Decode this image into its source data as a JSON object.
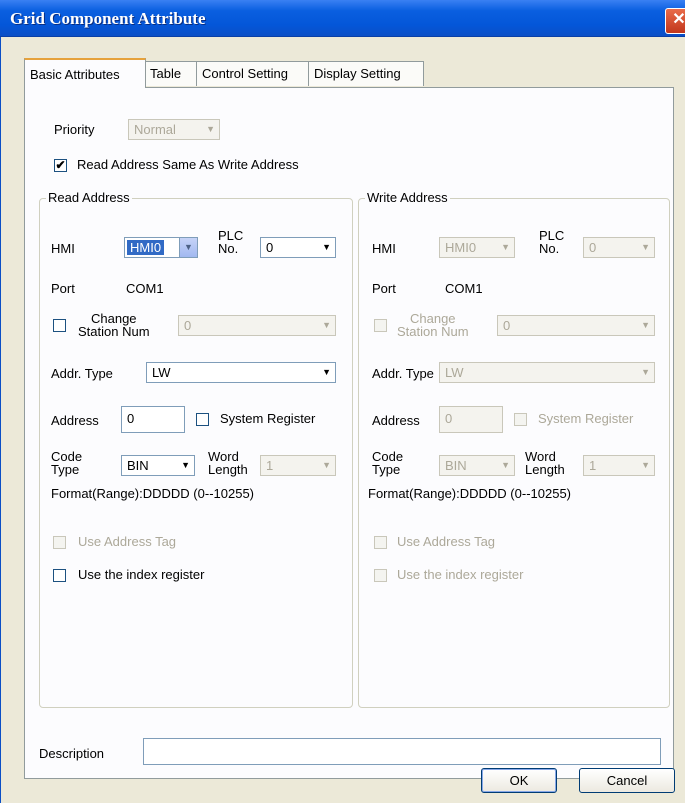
{
  "window": {
    "title": "Grid Component Attribute",
    "close_glyph": "✕"
  },
  "tabs": [
    {
      "label": "Basic Attributes"
    },
    {
      "label": "Table"
    },
    {
      "label": "Control Setting"
    },
    {
      "label": "Display Setting"
    }
  ],
  "priority": {
    "label": "Priority",
    "value": "Normal"
  },
  "same_address": {
    "label": "Read Address Same As Write Address",
    "checked": true
  },
  "read": {
    "title": "Read Address",
    "hmi_label": "HMI",
    "hmi_value": "HMI0",
    "plc_label_1": "PLC",
    "plc_label_2": "No.",
    "plc_value": "0",
    "port_label": "Port",
    "port_value": "COM1",
    "change_label_1": "Change",
    "change_label_2": "Station Num",
    "change_value": "0",
    "addr_type_label": "Addr. Type",
    "addr_type_value": "LW",
    "address_label": "Address",
    "address_value": "0",
    "system_register_label": "System Register",
    "code_label_1": "Code",
    "code_label_2": "Type",
    "code_value": "BIN",
    "word_label_1": "Word",
    "word_label_2": "Length",
    "word_value": "1",
    "format": "Format(Range):DDDDD (0--10255)",
    "use_tag_label": "Use Address Tag",
    "use_index_label": "Use the index register"
  },
  "write": {
    "title": "Write Address",
    "hmi_label": "HMI",
    "hmi_value": "HMI0",
    "plc_label_1": "PLC",
    "plc_label_2": "No.",
    "plc_value": "0",
    "port_label": "Port",
    "port_value": "COM1",
    "change_label_1": "Change",
    "change_label_2": "Station Num",
    "change_value": "0",
    "addr_type_label": "Addr. Type",
    "addr_type_value": "LW",
    "address_label": "Address",
    "address_value": "0",
    "system_register_label": "System Register",
    "code_label_1": "Code",
    "code_label_2": "Type",
    "code_value": "BIN",
    "word_label_1": "Word",
    "word_label_2": "Length",
    "word_value": "1",
    "format": "Format(Range):DDDDD (0--10255)",
    "use_tag_label": "Use Address Tag",
    "use_index_label": "Use the index register"
  },
  "description": {
    "label": "Description",
    "value": ""
  },
  "buttons": {
    "ok": "OK",
    "cancel": "Cancel"
  },
  "glyphs": {
    "check": "✔",
    "arrow": "▼"
  },
  "colors": {
    "titlebar": "#0456d8",
    "selection": "#316ac5",
    "dialog_bg": "#ece9d8"
  }
}
